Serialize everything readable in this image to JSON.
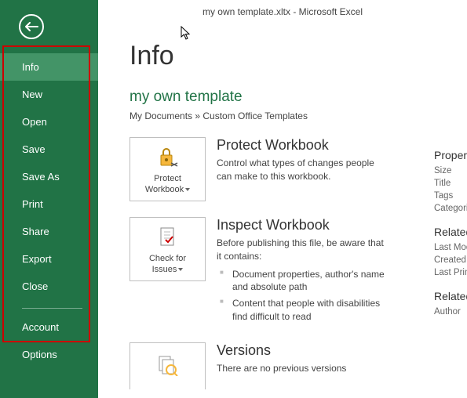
{
  "title_bar": "my own template.xltx - Microsoft Excel",
  "sidebar": {
    "items": [
      "Info",
      "New",
      "Open",
      "Save",
      "Save As",
      "Print",
      "Share",
      "Export",
      "Close"
    ],
    "bottom_items": [
      "Account",
      "Options"
    ]
  },
  "main": {
    "heading": "Info",
    "doc_title": "my own template",
    "doc_path": "My Documents » Custom Office Templates",
    "protect": {
      "button_line1": "Protect",
      "button_line2": "Workbook",
      "heading": "Protect Workbook",
      "desc": "Control what types of changes people can make to this workbook."
    },
    "inspect": {
      "button_line1": "Check for",
      "button_line2": "Issues",
      "heading": "Inspect Workbook",
      "desc": "Before publishing this file, be aware that it contains:",
      "bullets": [
        "Document properties, author's name and absolute path",
        "Content that people with disabilities find difficult to read"
      ]
    },
    "versions": {
      "heading": "Versions",
      "desc": "There are no previous versions"
    }
  },
  "right": {
    "properties_head": "Properties",
    "size": "Size",
    "title": "Title",
    "tags": "Tags",
    "categories": "Categories",
    "related_dates_head": "Related Dates",
    "last_mod": "Last Modified",
    "created": "Created",
    "last_print": "Last Printed",
    "related_people_head": "Related People",
    "author": "Author"
  }
}
